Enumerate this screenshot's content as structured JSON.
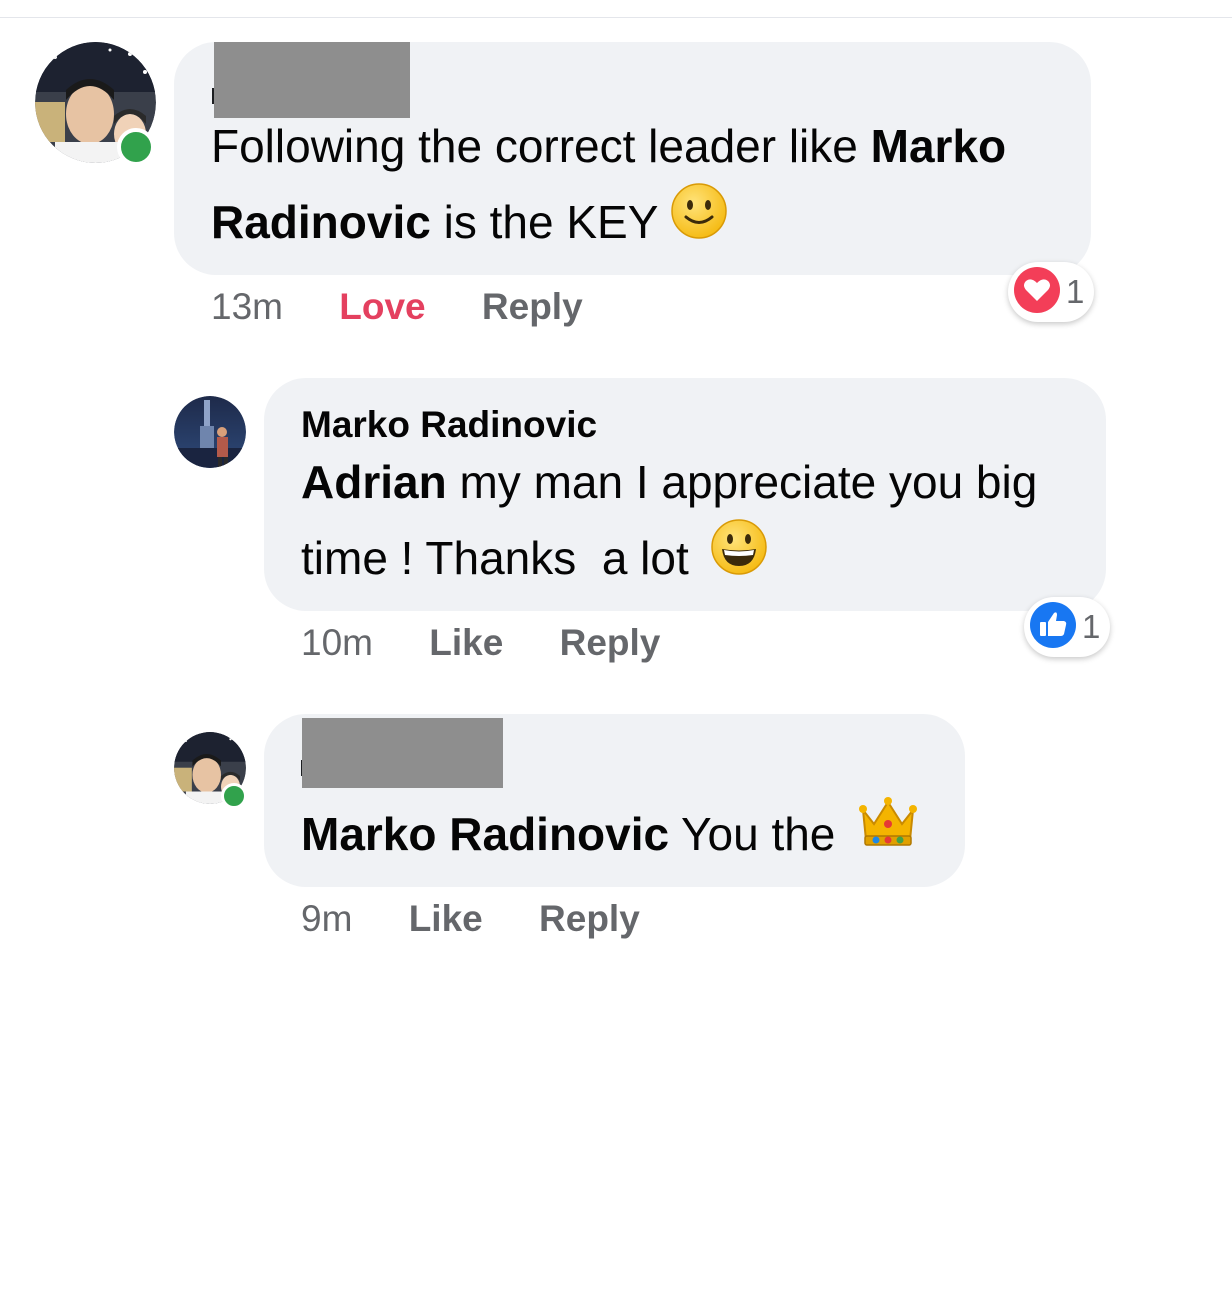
{
  "comments": [
    {
      "author_redacted": true,
      "text_parts": [
        {
          "text": "Following the correct leader like ",
          "bold": false
        },
        {
          "text": "Marko",
          "bold": true
        }
      ],
      "text_parts_line2": [
        {
          "text": "Radinovic",
          "bold": true
        },
        {
          "text": " is the KEY",
          "bold": false
        }
      ],
      "emoji": "slightly-smiling-face-icon",
      "time": "13m",
      "action_label": "Love",
      "reply_label": "Reply",
      "reaction": {
        "icon": "heart-reaction-icon",
        "count": "1",
        "color": "#f33e58"
      },
      "online": true
    },
    {
      "author": "Marko Radinovic",
      "line1_bold": "Adrian",
      "line1_rest": " my man I appreciate you big",
      "line2": "time ! Thanks  a lot",
      "emoji": "grinning-face-icon",
      "time": "10m",
      "action_label": "Like",
      "reply_label": "Reply",
      "reaction": {
        "icon": "like-reaction-icon",
        "count": "1",
        "color": "#1877f2"
      },
      "online": false
    },
    {
      "author_redacted": true,
      "mention": "Marko Radinovic",
      "text_rest": " You the",
      "emoji": "crown-icon",
      "time": "9m",
      "action_label": "Like",
      "reply_label": "Reply",
      "online": true
    }
  ],
  "colors": {
    "bubble": "#f0f2f5",
    "meta": "#65676b",
    "love": "#e4405f",
    "online": "#31a24c",
    "redaction": "#8e8e8e"
  }
}
